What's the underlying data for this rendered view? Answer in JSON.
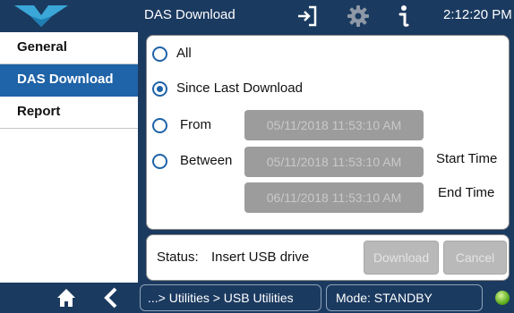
{
  "header": {
    "title": "DAS Download",
    "clock": "2:12:20 PM",
    "icons": [
      "logo-icon",
      "exit-icon",
      "gear-icon",
      "info-icon"
    ]
  },
  "sidebar": {
    "items": [
      {
        "label": "General",
        "active": false
      },
      {
        "label": "DAS Download",
        "active": true
      },
      {
        "label": "Report",
        "active": false
      }
    ]
  },
  "options": {
    "all": {
      "label": "All",
      "selected": false
    },
    "since_last": {
      "label": "Since Last Download",
      "selected": true
    },
    "from": {
      "label": "From",
      "selected": false,
      "value": "05/11/2018 11:53:10 AM"
    },
    "between": {
      "label": "Between",
      "selected": false,
      "start_value": "05/11/2018 11:53:10 AM",
      "end_value": "06/11/2018 11:53:10 AM",
      "start_label": "Start Time",
      "end_label": "End Time"
    }
  },
  "status": {
    "label": "Status:",
    "value": "Insert USB drive",
    "download_label": "Download",
    "cancel_label": "Cancel"
  },
  "footer": {
    "breadcrumb": "...> Utilities > USB Utilities",
    "mode": "Mode: STANDBY",
    "icons": [
      "home-icon",
      "back-icon",
      "status-led-icon"
    ]
  },
  "colors": {
    "bar": "#1b3a60",
    "accent": "#1f63a8",
    "disabled": "#9c9c9c",
    "led": "#5fae1f"
  }
}
